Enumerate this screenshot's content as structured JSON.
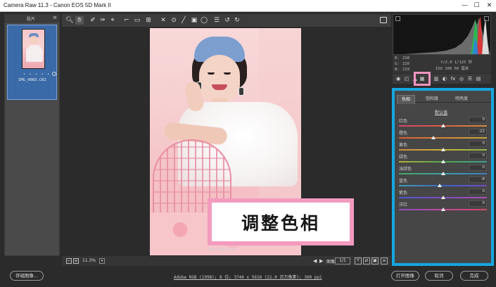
{
  "window": {
    "title": "Camera Raw 11.3  -  Canon EOS 5D Mark II",
    "min_glyph": "—",
    "max_glyph": "☐",
    "close_glyph": "✕"
  },
  "filmstrip": {
    "header_label": "胶片",
    "menu_glyph": "≡",
    "thumb_rating": "• • • • •",
    "thumb_filename": "IMG_0083.CR2"
  },
  "toolbar": {
    "tools": [
      "zoom-icon",
      "hand-icon",
      "white-balance-icon",
      "color-sampler-icon",
      "targeted-adjust-icon",
      "crop-icon",
      "straighten-icon",
      "transform-icon",
      "spot-removal-icon",
      "redeye-icon",
      "brush-icon",
      "graduated-filter-icon",
      "radial-filter-icon",
      "list-icon",
      "rotate-left-icon",
      "rotate-right-icon"
    ]
  },
  "canvas": {
    "image_filename": "IMG_0083.CR2",
    "overlay_caption": "调整色相",
    "zoom_minus": "−",
    "zoom_plus": "+",
    "zoom_value": "11.3%",
    "zoom_dropdown": "▾",
    "prev_glyph": "◀",
    "next_glyph": "▶",
    "page_label": "图像",
    "page_value": "1/1",
    "mini_btn_y": "Y"
  },
  "info": {
    "r_label": "R:",
    "r_value": "238",
    "g_label": "G:",
    "g_value": "220",
    "b_label": "B:",
    "b_value": "219",
    "aperture_shutter": "f/2.0  1/125 秒",
    "iso_focal": "ISO 100  50 毫米"
  },
  "panel_tabs": [
    "basic-icon",
    "tone-curve-icon",
    "detail-icon",
    "hsl-icon",
    "split-tone-icon",
    "lens-icon",
    "effects-icon",
    "calibration-icon",
    "presets-icon",
    "snapshots-icon"
  ],
  "hsl": {
    "tabs": [
      "色相",
      "饱和度",
      "明亮度"
    ],
    "active_tab": 0,
    "default_link": "默认值",
    "sliders": [
      {
        "name": "红色",
        "value": "0",
        "level": 0.5,
        "gradient": "linear-gradient(90deg,#d8456f,#d9603f,#d88a3a)"
      },
      {
        "name": "橙色",
        "value": "-22",
        "level": 0.39,
        "gradient": "linear-gradient(90deg,#d75c36,#d7863a,#c9a93a)"
      },
      {
        "name": "黄色",
        "value": "0",
        "level": 0.5,
        "gradient": "linear-gradient(90deg,#d18c39,#c7b43a,#8fb63d)"
      },
      {
        "name": "绿色",
        "value": "0",
        "level": 0.5,
        "gradient": "linear-gradient(90deg,#b5b43b,#4fa74a,#3aa19a)"
      },
      {
        "name": "浅绿色",
        "value": "0",
        "level": 0.5,
        "gradient": "linear-gradient(90deg,#49a56a,#38a3a4,#3b7cc6)"
      },
      {
        "name": "蓝色",
        "value": "-8",
        "level": 0.46,
        "gradient": "linear-gradient(90deg,#3ba0b8,#3d66c8,#6d4bc6)"
      },
      {
        "name": "紫色",
        "value": "0",
        "level": 0.5,
        "gradient": "linear-gradient(90deg,#4b58c9,#7e4ac7,#b24fb7)"
      },
      {
        "name": "洋红",
        "value": "0",
        "level": 0.5,
        "gradient": "linear-gradient(90deg,#8f4cc4,#c34a9c,#d64567)"
      }
    ]
  },
  "footer": {
    "save_label": "存储图像...",
    "workflow_link": "Adobe RGB (1998); 8 位; 3744 x 5616 (21.0 百万像素); 300 ppi",
    "open_label": "打开图像",
    "cancel_label": "取消",
    "done_label": "完成"
  },
  "colors": {
    "highlight_pink": "#f394c0",
    "highlight_blue": "#15a7e0",
    "panel_bg": "#464646",
    "app_bg": "#2b2b2b"
  }
}
